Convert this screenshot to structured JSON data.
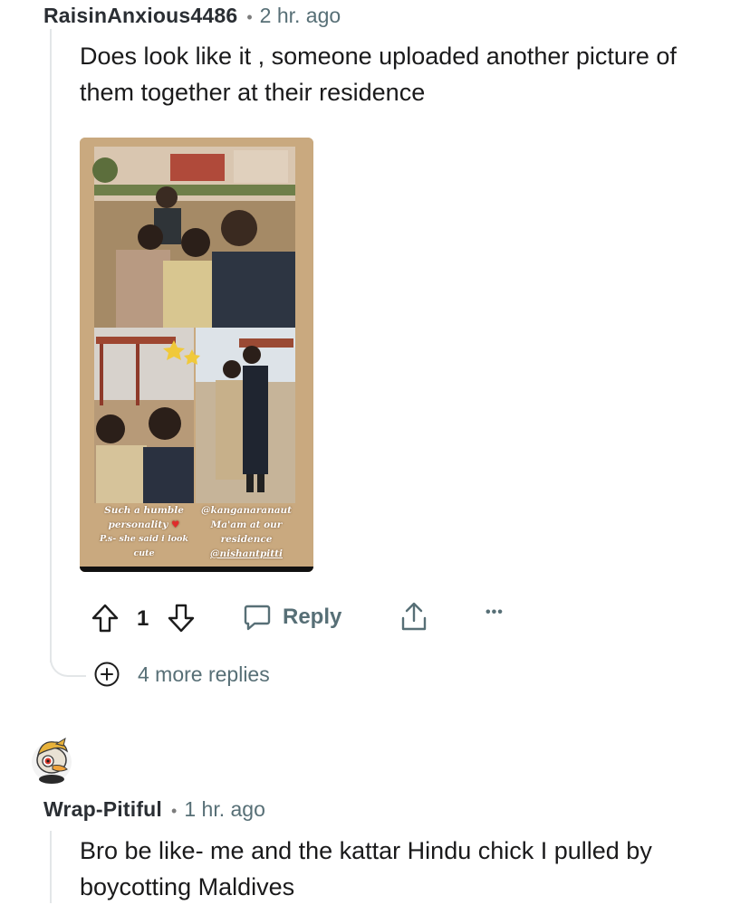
{
  "comment1": {
    "username": "RaisinAnxious4486",
    "separator": "•",
    "time": "2 hr. ago",
    "text": "Does look like it , someone uploaded another picture of them together at their residence",
    "image": {
      "caption_left_1": "Such a humble",
      "caption_left_2": "personality",
      "caption_left_3": "P.s- she said i look",
      "caption_left_4": "cute",
      "caption_right_1": "@kanganaranaut",
      "caption_right_2": "Ma'am at our",
      "caption_right_3": "residence",
      "caption_right_4": "@nishantpitti"
    },
    "actions": {
      "upvote_icon": "upvote-arrow-icon",
      "vote_count": "1",
      "downvote_icon": "downvote-arrow-icon",
      "reply_icon": "speech-bubble-icon",
      "reply_label": "Reply",
      "share_icon": "share-icon",
      "more_icon": "ellipsis-icon",
      "more_label": "•••"
    },
    "more_replies": "4 more replies"
  },
  "comment2": {
    "username": "Wrap-Pitiful",
    "separator": "•",
    "time": "1 hr. ago",
    "text": "Bro be like- me and the kattar Hindu chick I pulled by boycotting Maldives",
    "avatar_icon": "snoo-avatar-icon"
  },
  "colors": {
    "meta_gray": "#576f76",
    "thread_line": "#e3e6e8"
  }
}
